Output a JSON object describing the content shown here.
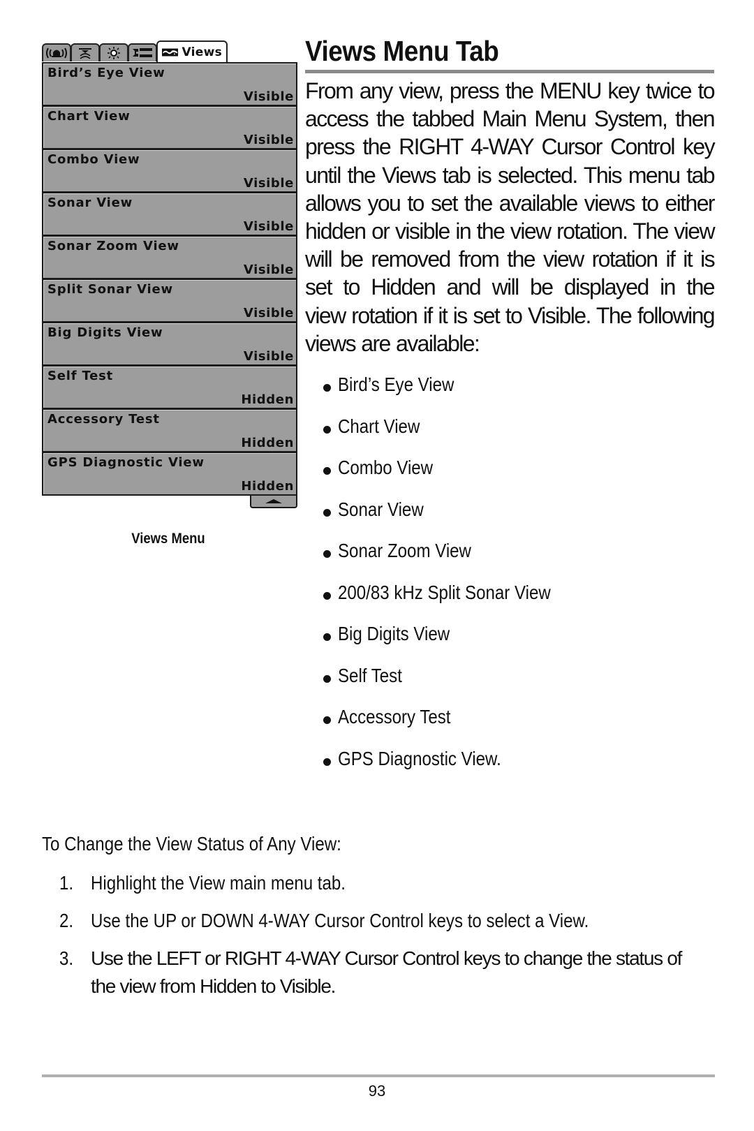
{
  "figure": {
    "tabs": [
      {
        "icon": "alarm-bell-icon",
        "label": ""
      },
      {
        "icon": "sonar-icon",
        "label": ""
      },
      {
        "icon": "setup-sun-icon",
        "label": ""
      },
      {
        "icon": "accessory-wrench-icon",
        "label": ""
      },
      {
        "icon": "views-map-icon",
        "label": "Views",
        "active": true
      }
    ],
    "menu_items": [
      {
        "name": "Bird’s Eye View",
        "status": "Visible"
      },
      {
        "name": "Chart View",
        "status": "Visible"
      },
      {
        "name": "Combo View",
        "status": "Visible"
      },
      {
        "name": "Sonar View",
        "status": "Visible"
      },
      {
        "name": "Sonar Zoom View",
        "status": "Visible"
      },
      {
        "name": "Split Sonar View",
        "status": "Visible"
      },
      {
        "name": "Big Digits View",
        "status": "Visible"
      },
      {
        "name": "Self Test",
        "status": "Hidden"
      },
      {
        "name": "Accessory Test",
        "status": "Hidden"
      },
      {
        "name": "GPS Diagnostic View",
        "status": "Hidden"
      }
    ],
    "scroll_icon": "scroll-up-arrow-icon",
    "caption": "Views Menu"
  },
  "section": {
    "title": "Views Menu Tab",
    "intro": "From any view, press the MENU key twice to access the tabbed Main Menu System, then press the RIGHT 4-WAY Cursor Control key until the Views tab is selected. This menu tab allows you to set the available views to either hidden or visible in the view rotation.  The view will be removed from the view rotation if it is set to Hidden and will be displayed in the view rotation if it is set to Visible. The following views are available:",
    "views_list": [
      "Bird’s Eye View",
      "Chart View",
      "Combo View",
      "Sonar View",
      "Sonar Zoom View",
      "200/83 kHz Split Sonar View",
      "Big Digits View",
      "Self Test",
      "Accessory Test",
      "GPS Diagnostic View."
    ]
  },
  "procedure": {
    "heading": "To Change the View Status of Any View:",
    "steps": [
      {
        "num": "1.",
        "text": "Highlight the View main menu tab."
      },
      {
        "num": "2.",
        "text": "Use the UP or DOWN 4-WAY Cursor Control keys to select a View."
      },
      {
        "num": "3.",
        "text": "Use the LEFT or RIGHT 4-WAY Cursor Control keys to change the status of the view from Hidden to Visible."
      }
    ]
  },
  "footer": {
    "page_number": "93"
  }
}
